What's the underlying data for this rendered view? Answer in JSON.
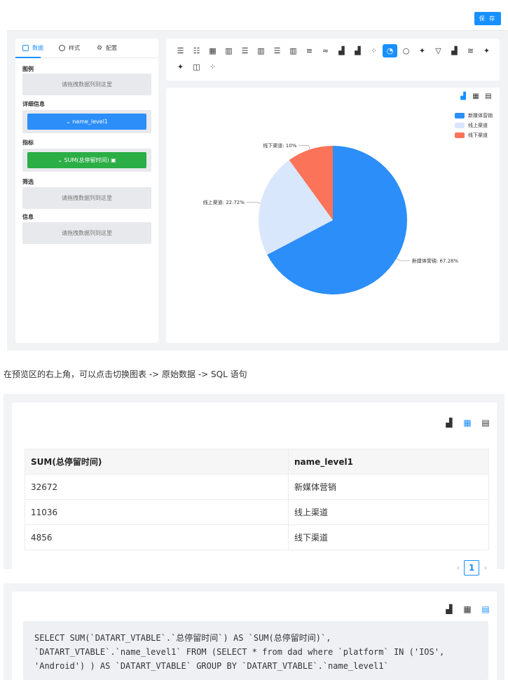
{
  "toolbar": {
    "save_label": "保 存"
  },
  "left_panel": {
    "tabs": [
      {
        "label": "数据",
        "icon": "file-icon",
        "active": true
      },
      {
        "label": "样式",
        "icon": "clock-icon",
        "active": false
      },
      {
        "label": "配置",
        "icon": "gear-icon",
        "active": false
      }
    ],
    "sections": {
      "legend": {
        "label": "图例",
        "drop_text": "请拖拽数据列到这里"
      },
      "detail": {
        "label": "详细信息",
        "pill": "name_level1"
      },
      "metric": {
        "label": "指标",
        "pill": "SUM(总停留时间)"
      },
      "filter": {
        "label": "筛选",
        "drop_text": "请拖拽数据列到这里"
      },
      "info": {
        "label": "信息",
        "drop_text": "请拖拽数据列到这里"
      }
    }
  },
  "chart_types": [
    "table-icon",
    "pivot-icon",
    "grid-icon",
    "bar-icon",
    "hbar-icon",
    "bar2-icon",
    "hbar2-icon",
    "column-icon",
    "stack-icon",
    "line-wave-icon",
    "area-icon",
    "area2-icon",
    "scatter-icon",
    "pie-icon",
    "donut-icon",
    "map-icon",
    "funnel-icon",
    "bar-line-icon",
    "wordcloud-icon",
    "map2-icon",
    "map3-icon",
    "kpi-icon",
    "scatter2-icon"
  ],
  "chart_data": {
    "type": "pie",
    "series": [
      {
        "name": "新媒体营销",
        "value": 67.28,
        "label": "新媒体营销: 67.28%",
        "color": "#2c8ef8"
      },
      {
        "name": "线上渠道",
        "value": 22.72,
        "label": "线上渠道: 22.72%",
        "color": "#d9e7fc"
      },
      {
        "name": "线下渠道",
        "value": 10,
        "label": "线下渠道: 10%",
        "color": "#fb7358"
      }
    ],
    "legend_position": "top-right"
  },
  "caption": "在预览区的右上角，可以点击切换图表 -> 原始数据 -> SQL 语句",
  "table": {
    "headers": [
      "SUM(总停留时间)",
      "name_level1"
    ],
    "rows": [
      [
        "32672",
        "新媒体营销"
      ],
      [
        "11036",
        "线上渠道"
      ],
      [
        "4856",
        "线下渠道"
      ]
    ],
    "page": "1"
  },
  "sql": {
    "text": "SELECT SUM(`DATART_VTABLE`.`总停留时间`) AS `SUM(总停留时间)`,\n`DATART_VTABLE`.`name_level1` FROM (SELECT * from dad where `platform` IN ('IOS',\n'Android') ) AS `DATART_VTABLE` GROUP BY `DATART_VTABLE`.`name_level1`"
  },
  "colors": {
    "accent": "#1890ff",
    "pill_blue": "#2c8ef8",
    "pill_green": "#2aae45"
  }
}
